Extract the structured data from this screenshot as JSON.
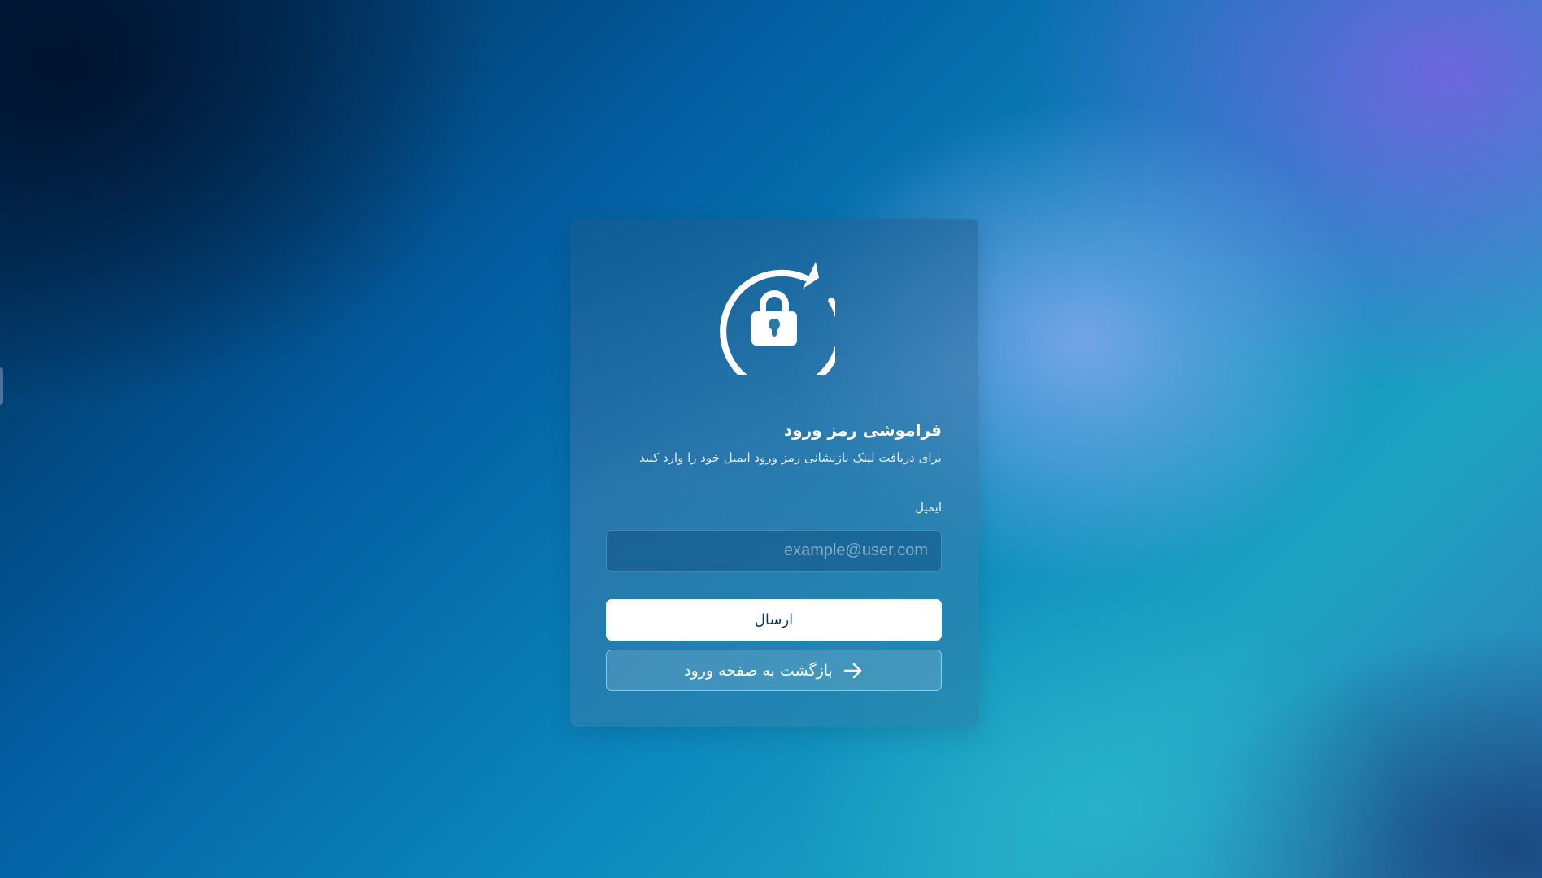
{
  "page": {
    "title": "فراموشی رمز ورود",
    "subtitle": "برای دریافت لینک بازنشانی رمز ورود ایمیل خود را وارد کنید"
  },
  "icons": {
    "logo": "lock-reset-icon",
    "back_arrow": "arrow-right-icon"
  },
  "form": {
    "email": {
      "label": "ایمیل",
      "value": "",
      "placeholder": "example@user.com"
    },
    "submit_label": "ارسال",
    "back_label": "بازگشت به صفحه ورود"
  },
  "colors": {
    "card_bg": "#2f78a8",
    "button_bg": "#ffffff",
    "button_text": "#073a5a"
  }
}
